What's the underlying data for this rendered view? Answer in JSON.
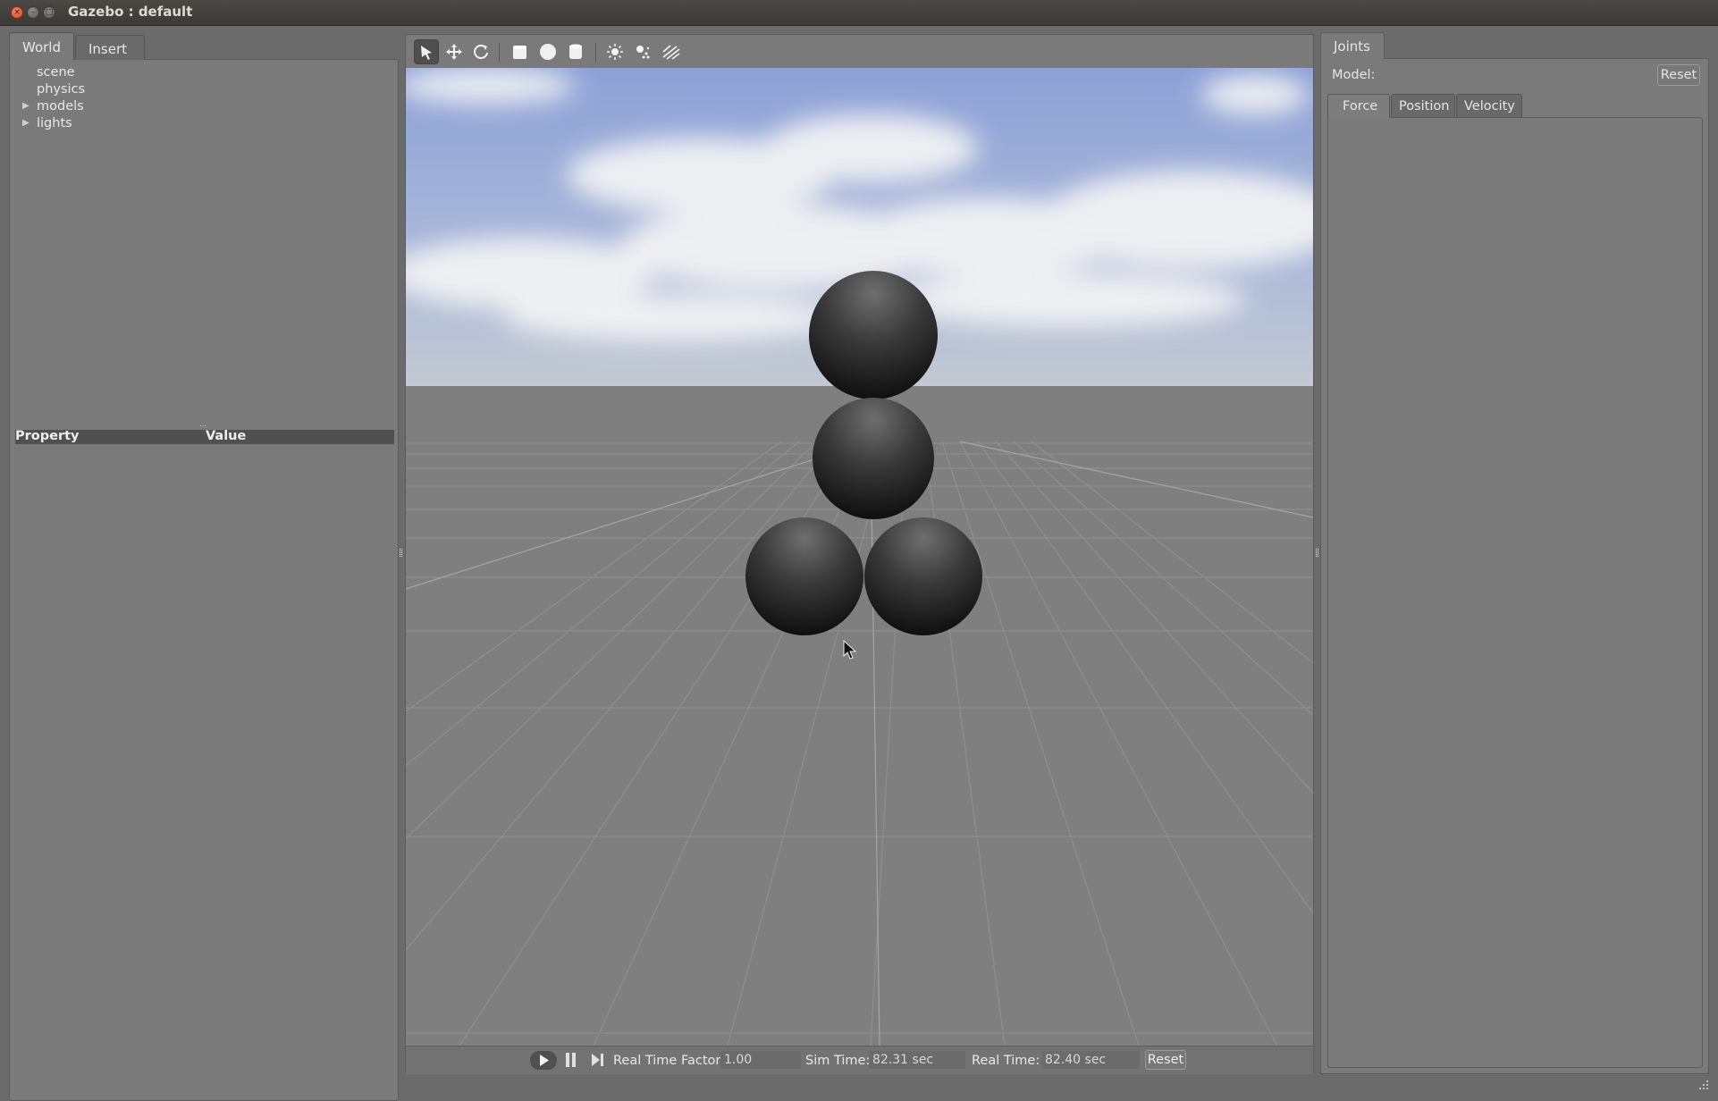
{
  "window": {
    "title": "Gazebo : default",
    "close_glyph": "×",
    "min_glyph": "–",
    "max_glyph": "□"
  },
  "left_panel": {
    "tabs": [
      {
        "label": "World",
        "active": true
      },
      {
        "label": "Insert",
        "active": false
      }
    ],
    "tree": [
      {
        "label": "scene",
        "expandable": false
      },
      {
        "label": "physics",
        "expandable": false
      },
      {
        "label": "models",
        "expandable": true
      },
      {
        "label": "lights",
        "expandable": true
      }
    ],
    "tree_arrow": "▶",
    "property_table": {
      "columns": [
        "Property",
        "Value"
      ],
      "splitter": "⋯"
    }
  },
  "toolbar": {
    "tools": [
      {
        "icon": "arrow-select-icon",
        "active": true
      },
      {
        "icon": "translate-icon"
      },
      {
        "icon": "rotate-icon"
      },
      {
        "icon": "box-shape-icon"
      },
      {
        "icon": "sphere-shape-icon"
      },
      {
        "icon": "cylinder-shape-icon"
      },
      {
        "icon": "point-light-icon"
      },
      {
        "icon": "spot-light-icon"
      },
      {
        "icon": "directional-light-icon"
      }
    ]
  },
  "bottom_bar": {
    "real_time_factor_label": "Real Time Factor:",
    "real_time_factor": "1.00",
    "sim_time_label": "Sim Time:",
    "sim_time": "82.31 sec",
    "real_time_label": "Real Time:",
    "real_time": "82.40 sec",
    "reset_label": "Reset"
  },
  "right_panel": {
    "tab": "Joints",
    "model_label": "Model:",
    "reset_label": "Reset",
    "subtabs": [
      {
        "label": "Force",
        "active": true
      },
      {
        "label": "Position",
        "active": false
      },
      {
        "label": "Velocity",
        "active": false
      }
    ]
  },
  "colors": {
    "panel_bg": "#7a7a7a",
    "sky_top": "#8fa3d8",
    "ground": "#7f7f7f",
    "sphere_dark": "#101010",
    "sphere_light": "#6e6e6e"
  }
}
